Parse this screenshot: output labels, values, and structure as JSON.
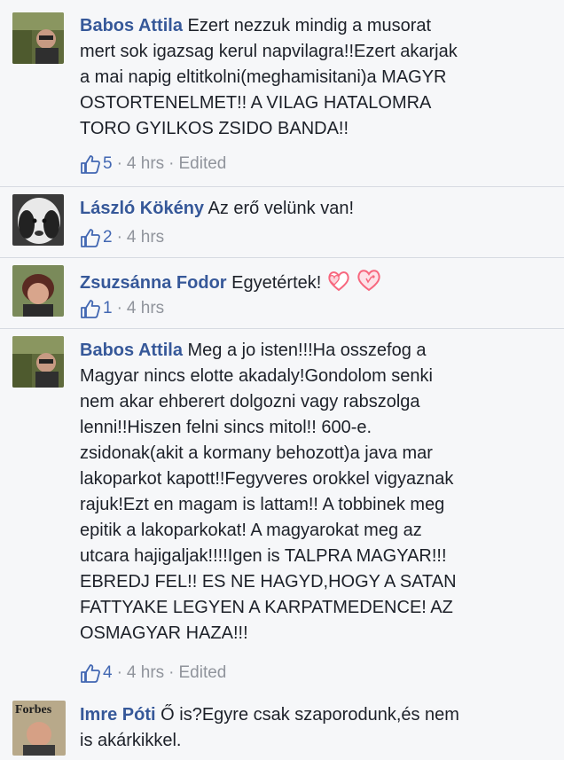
{
  "comments": [
    {
      "author": "Babos Attila",
      "text": "Ezert nezzuk mindig a musorat\nmert sok igazsag kerul napvilagra!!Ezert akarjak\na mai napig eltitkolni(meghamisitani)a MAGYR\nOSTORTENELMET!! A VILAG HATALOMRA\nTORO GYILKOS ZSIDO BANDA!!",
      "likes": "5",
      "time": "4 hrs",
      "edited": "Edited"
    },
    {
      "author": "László Kökény",
      "text": "Az erő velünk van!",
      "likes": "2",
      "time": "4 hrs"
    },
    {
      "author": "Zsuzsánna Fodor",
      "text": "Egyetértek!",
      "likes": "1",
      "time": "4 hrs"
    },
    {
      "author": "Babos Attila",
      "text": "Meg a jo isten!!!Ha osszefog a\nMagyar nincs elotte akadaly!Gondolom senki\nnem akar ehberert dolgozni vagy rabszolga\nlenni!!Hiszen felni sincs mitol!! 600-e.\nzsidonak(akit a kormany behozott)a java mar\nlakoparkot kapott!!Fegyveres orokkel vigyaznak\nrajuk!Ezt en magam is lattam!! A tobbinek meg\nepitik a lakoparkokat! A magyarokat meg az\nutcara hajigaljak!!!!Igen is TALPRA MAGYAR!!!\nEBREDJ FEL!! ES NE HAGYD,HOGY A SATAN\nFATTYAKE LEGYEN A KARPATMEDENCE! AZ\nOSMAGYAR HAZA!!!",
      "likes": "4",
      "time": "4 hrs",
      "edited": "Edited"
    },
    {
      "author": "Imre Póti",
      "text": "Ő is?Egyre csak szaporodunk,és nem\nis akárkikkel."
    }
  ],
  "separator": "·",
  "avatar_labels": {
    "forbes": "Forbes"
  },
  "colors": {
    "author": "#365899",
    "like": "#4267b2",
    "meta": "#90949c",
    "heart": "#f7677e"
  }
}
